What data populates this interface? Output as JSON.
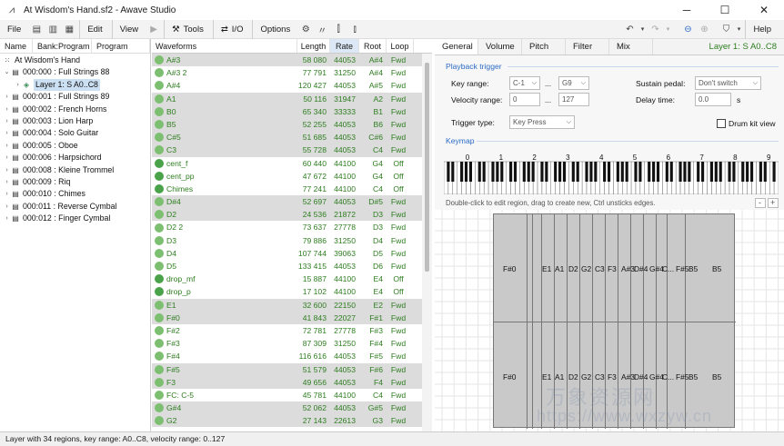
{
  "window": {
    "title": "At Wisdom's Hand.sf2 - Awave Studio",
    "minimize": "─",
    "maximize": "☐",
    "close": "✕"
  },
  "menu": {
    "file": "File",
    "edit": "Edit",
    "view": "View",
    "tools": "Tools",
    "io": "I/O",
    "options": "Options",
    "bookmarks": "",
    "help": "Help"
  },
  "left_panel": {
    "headers": [
      "Name",
      "Bank:Program",
      "Program"
    ],
    "root": "At Wisdom's Hand",
    "items": [
      {
        "label": "000:000 : Full Strings 88",
        "expanded": true
      },
      {
        "label": "Layer 1: S A0..C8",
        "child": true,
        "selected": true
      },
      {
        "label": "000:001 : Full Strings 89"
      },
      {
        "label": "000:002 : French Horns"
      },
      {
        "label": "000:003 : Lion Harp"
      },
      {
        "label": "000:004 : Solo Guitar"
      },
      {
        "label": "000:005 : Oboe"
      },
      {
        "label": "000:006 : Harpsichord"
      },
      {
        "label": "000:008 : Kleine Trommel"
      },
      {
        "label": "000:009 : Riq"
      },
      {
        "label": "000:010 : Chimes"
      },
      {
        "label": "000:011 : Reverse Cymbal"
      },
      {
        "label": "000:012 : Finger Cymbal"
      }
    ]
  },
  "waveforms": {
    "headers": {
      "name": "Waveforms",
      "length": "Length",
      "rate": "Rate",
      "root": "Root",
      "loop": "Loop"
    },
    "rows": [
      {
        "name": "A#3",
        "length": "58 080",
        "rate": "44053",
        "root": "A#4",
        "loop": "Fwd",
        "g": true
      },
      {
        "name": "A#3 2",
        "length": "77 791",
        "rate": "31250",
        "root": "A#4",
        "loop": "Fwd"
      },
      {
        "name": "A#4",
        "length": "120 427",
        "rate": "44053",
        "root": "A#5",
        "loop": "Fwd"
      },
      {
        "name": "A1",
        "length": "50 116",
        "rate": "31947",
        "root": "A2",
        "loop": "Fwd",
        "g": true
      },
      {
        "name": "B0",
        "length": "65 340",
        "rate": "33333",
        "root": "B1",
        "loop": "Fwd",
        "g": true
      },
      {
        "name": "B5",
        "length": "52 255",
        "rate": "44053",
        "root": "B6",
        "loop": "Fwd",
        "g": true
      },
      {
        "name": "C#5",
        "length": "51 685",
        "rate": "44053",
        "root": "C#6",
        "loop": "Fwd",
        "g": true
      },
      {
        "name": "C3",
        "length": "55 728",
        "rate": "44053",
        "root": "C4",
        "loop": "Fwd",
        "g": true
      },
      {
        "name": "cent_f",
        "length": "60 440",
        "rate": "44100",
        "root": "G4",
        "loop": "Off",
        "st": true
      },
      {
        "name": "cent_pp",
        "length": "47 672",
        "rate": "44100",
        "root": "G4",
        "loop": "Off",
        "st": true
      },
      {
        "name": "Chimes",
        "length": "77 241",
        "rate": "44100",
        "root": "C4",
        "loop": "Off",
        "st": true
      },
      {
        "name": "D#4",
        "length": "52 697",
        "rate": "44053",
        "root": "D#5",
        "loop": "Fwd",
        "g": true
      },
      {
        "name": "D2",
        "length": "24 536",
        "rate": "21872",
        "root": "D3",
        "loop": "Fwd",
        "g": true
      },
      {
        "name": "D2 2",
        "length": "73 637",
        "rate": "27778",
        "root": "D3",
        "loop": "Fwd"
      },
      {
        "name": "D3",
        "length": "79 886",
        "rate": "31250",
        "root": "D4",
        "loop": "Fwd"
      },
      {
        "name": "D4",
        "length": "107 744",
        "rate": "39063",
        "root": "D5",
        "loop": "Fwd"
      },
      {
        "name": "D5",
        "length": "133 415",
        "rate": "44053",
        "root": "D6",
        "loop": "Fwd"
      },
      {
        "name": "drop_mf",
        "length": "15 887",
        "rate": "44100",
        "root": "E4",
        "loop": "Off",
        "st": true
      },
      {
        "name": "drop_p",
        "length": "17 102",
        "rate": "44100",
        "root": "E4",
        "loop": "Off",
        "st": true
      },
      {
        "name": "E1",
        "length": "32 600",
        "rate": "22150",
        "root": "E2",
        "loop": "Fwd",
        "g": true
      },
      {
        "name": "F#0",
        "length": "41 843",
        "rate": "22027",
        "root": "F#1",
        "loop": "Fwd",
        "g": true
      },
      {
        "name": "F#2",
        "length": "72 781",
        "rate": "27778",
        "root": "F#3",
        "loop": "Fwd"
      },
      {
        "name": "F#3",
        "length": "87 309",
        "rate": "31250",
        "root": "F#4",
        "loop": "Fwd"
      },
      {
        "name": "F#4",
        "length": "116 616",
        "rate": "44053",
        "root": "F#5",
        "loop": "Fwd"
      },
      {
        "name": "F#5",
        "length": "51 579",
        "rate": "44053",
        "root": "F#6",
        "loop": "Fwd",
        "g": true
      },
      {
        "name": "F3",
        "length": "49 656",
        "rate": "44053",
        "root": "F4",
        "loop": "Fwd",
        "g": true
      },
      {
        "name": "FC: C-5",
        "length": "45 781",
        "rate": "44100",
        "root": "C4",
        "loop": "Fwd"
      },
      {
        "name": "G#4",
        "length": "52 062",
        "rate": "44053",
        "root": "G#5",
        "loop": "Fwd",
        "g": true
      },
      {
        "name": "G2",
        "length": "27 143",
        "rate": "22613",
        "root": "G3",
        "loop": "Fwd",
        "g": true
      }
    ]
  },
  "right_panel": {
    "tabs": [
      "General",
      "Volume",
      "Pitch",
      "Filter",
      "Mix"
    ],
    "layer_label": "Layer 1: S A0..C8",
    "playback_group": "Playback trigger",
    "key_range_label": "Key range:",
    "key_range_from": "C-1",
    "key_range_to": "G9",
    "velocity_label": "Velocity range:",
    "velocity_from": "0",
    "velocity_to": "127",
    "dots": "...",
    "sustain_label": "Sustain pedal:",
    "sustain_value": "Don't switch",
    "delay_label": "Delay time:",
    "delay_value": "0.0",
    "delay_unit": "s",
    "trigger_label": "Trigger type:",
    "trigger_value": "Key Press",
    "drum_label": "Drum kit view",
    "keymap_group": "Keymap",
    "octaves": [
      "0",
      "1",
      "2",
      "3",
      "4",
      "5",
      "6",
      "7",
      "8",
      "9"
    ],
    "hint": "Double-click to edit region, drag to create new, Ctrl unsticks edges.",
    "zoom_out": "-",
    "zoom_in": "+",
    "region_labels": [
      "F#0",
      "E1",
      "A1",
      "D2",
      "G2",
      "C3",
      "F3",
      "A#3",
      "D#4",
      "G#4",
      "C...",
      "F#5",
      "B5",
      "B5"
    ]
  },
  "status": "Layer with 34 regions, key range: A0..C8, velocity range: 0..127",
  "watermark": {
    "line1": "万象资源网",
    "line2": "https://www.wxzyw.cn"
  }
}
